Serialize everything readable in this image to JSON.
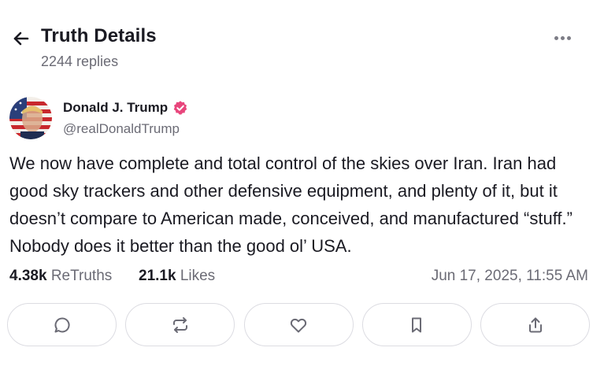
{
  "header": {
    "title": "Truth Details",
    "replies": "2244 replies",
    "back_icon": "arrow-left-icon",
    "more_icon": "more-horizontal-icon"
  },
  "post": {
    "author_name": "Donald J. Trump",
    "author_handle": "@realDonaldTrump",
    "verified_badge_color": "#e8467c",
    "text": "We now have complete and total control of the skies over Iran. Iran had good sky trackers and other defensive equipment, and plenty of it, but it doesn’t compare to American made, conceived, and manufactured “stuff.”  Nobody does it better than the good ol’ USA.",
    "retruths_count": "4.38k",
    "retruths_label": "ReTruths",
    "likes_count": "21.1k",
    "likes_label": "Likes",
    "timestamp": "Jun 17, 2025, 11:55 AM"
  },
  "actions": [
    {
      "name": "reply",
      "icon": "comment-icon"
    },
    {
      "name": "retruth",
      "icon": "repost-icon"
    },
    {
      "name": "like",
      "icon": "heart-icon"
    },
    {
      "name": "bookmark",
      "icon": "bookmark-icon"
    },
    {
      "name": "share",
      "icon": "share-icon"
    }
  ],
  "colors": {
    "text_primary": "#1a1a22",
    "text_secondary": "#6b6b75",
    "border": "#dcdce2",
    "icon": "#6b6b75"
  }
}
